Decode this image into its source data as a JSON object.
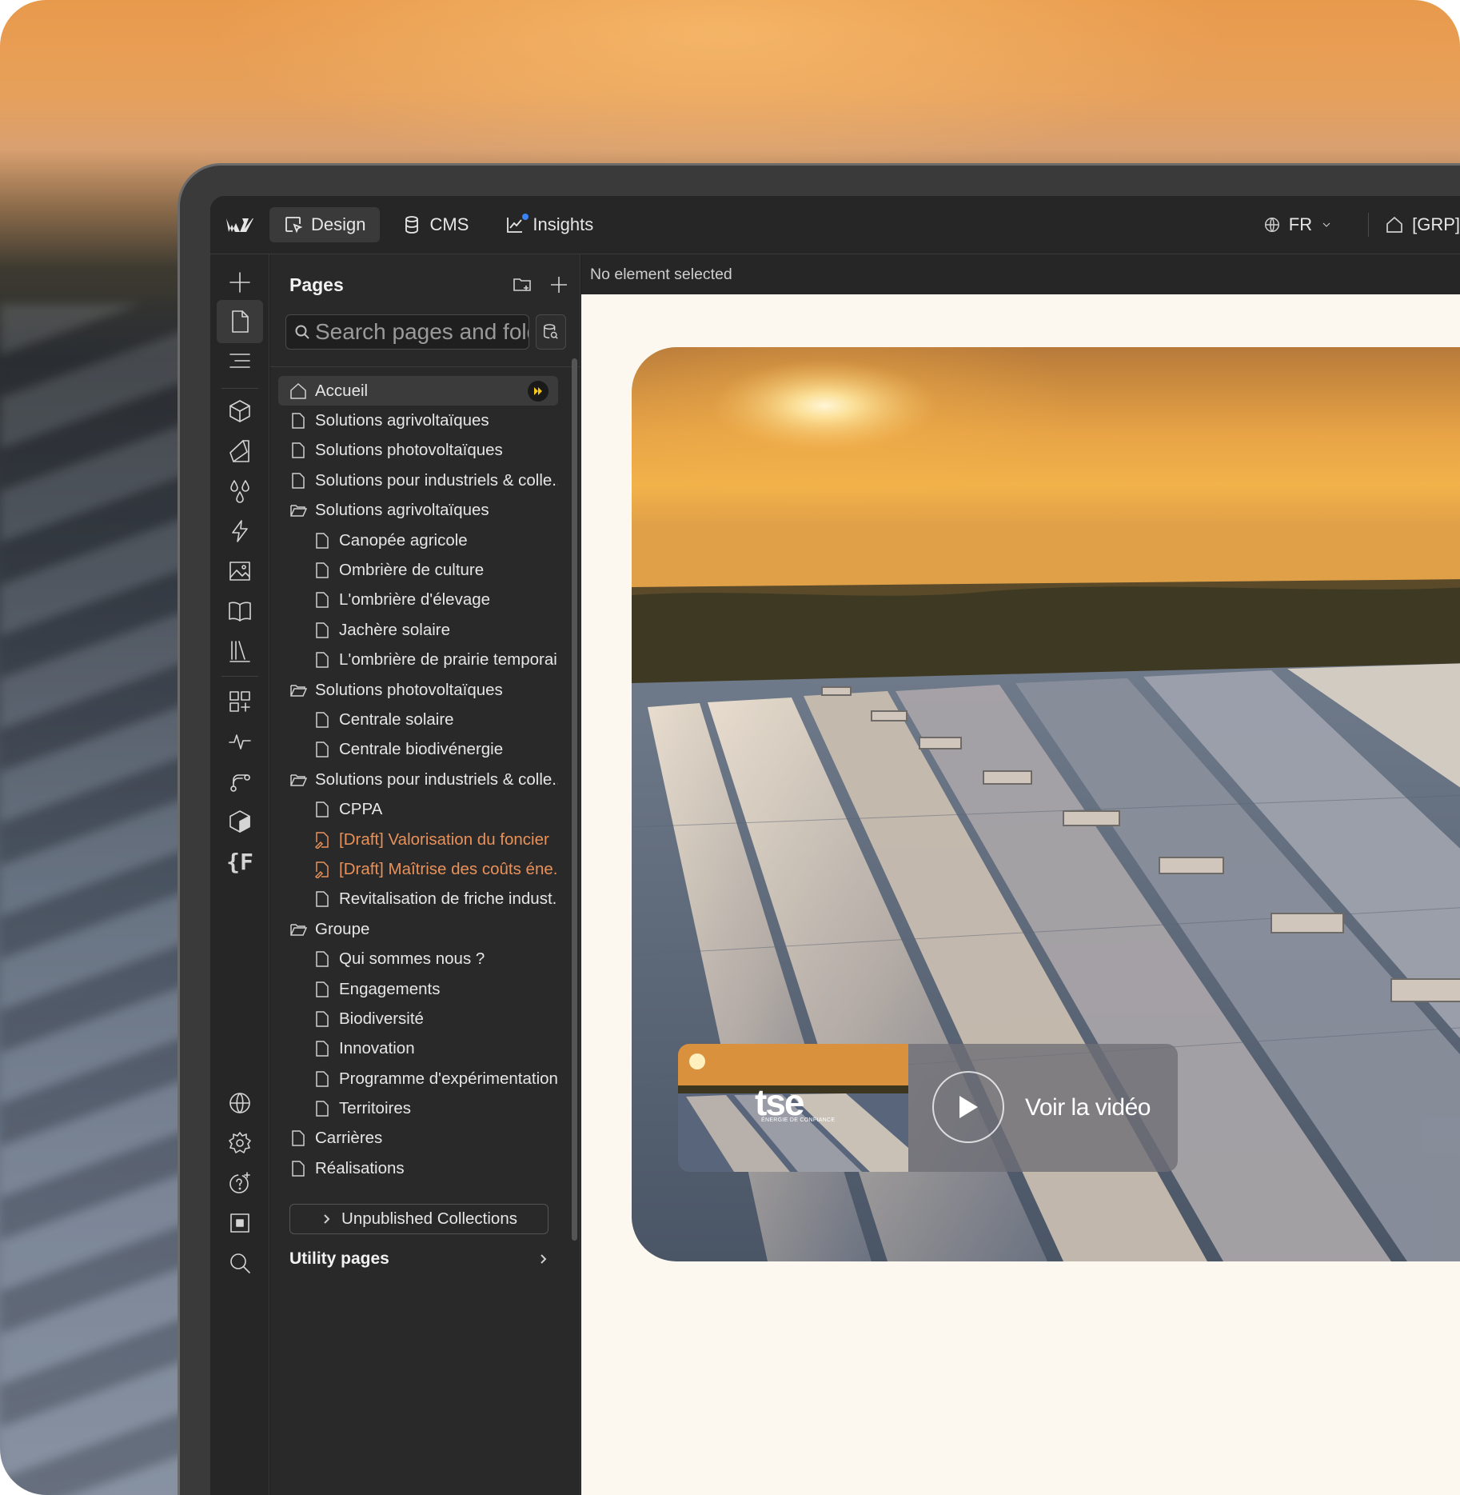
{
  "topbar": {
    "tabs": [
      {
        "label": "Design",
        "icon": "cursor-frame-icon",
        "active": true
      },
      {
        "label": "CMS",
        "icon": "database-icon"
      },
      {
        "label": "Insights",
        "icon": "chart-line-icon"
      }
    ],
    "language": "FR",
    "site_label": "[GRP]"
  },
  "pages_panel": {
    "title": "Pages",
    "search_placeholder": "Search pages and folders",
    "items": [
      {
        "label": "Accueil",
        "type": "home",
        "level": 0,
        "active": true
      },
      {
        "label": "Solutions agrivoltaïques",
        "type": "page",
        "level": 0
      },
      {
        "label": "Solutions photovoltaïques",
        "type": "page",
        "level": 0
      },
      {
        "label": "Solutions pour industriels & colle...",
        "type": "page",
        "level": 0
      },
      {
        "label": "Solutions agrivoltaïques",
        "type": "folder",
        "level": 0
      },
      {
        "label": "Canopée agricole",
        "type": "page",
        "level": 1
      },
      {
        "label": "Ombrière de culture",
        "type": "page",
        "level": 1
      },
      {
        "label": "L'ombrière d'élevage",
        "type": "page",
        "level": 1
      },
      {
        "label": "Jachère solaire",
        "type": "page",
        "level": 1
      },
      {
        "label": "L'ombrière de prairie temporai...",
        "type": "page",
        "level": 1
      },
      {
        "label": "Solutions photovoltaïques",
        "type": "folder",
        "level": 0
      },
      {
        "label": "Centrale solaire",
        "type": "page",
        "level": 1
      },
      {
        "label": "Centrale biodivénergie",
        "type": "page",
        "level": 1
      },
      {
        "label": "Solutions pour industriels & colle...",
        "type": "folder",
        "level": 0
      },
      {
        "label": "CPPA",
        "type": "page",
        "level": 1
      },
      {
        "label": "[Draft] Valorisation du foncier",
        "type": "draft",
        "level": 1
      },
      {
        "label": "[Draft] Maîtrise des coûts éne...",
        "type": "draft",
        "level": 1
      },
      {
        "label": "Revitalisation de friche indust...",
        "type": "page",
        "level": 1
      },
      {
        "label": "Groupe",
        "type": "folder",
        "level": 0
      },
      {
        "label": "Qui sommes nous ?",
        "type": "page",
        "level": 1
      },
      {
        "label": "Engagements",
        "type": "page",
        "level": 1
      },
      {
        "label": "Biodiversité",
        "type": "page",
        "level": 1
      },
      {
        "label": "Innovation",
        "type": "page",
        "level": 1
      },
      {
        "label": "Programme d'expérimentation",
        "type": "page",
        "level": 1
      },
      {
        "label": "Territoires",
        "type": "page",
        "level": 1
      },
      {
        "label": "Carrières",
        "type": "page",
        "level": 0
      },
      {
        "label": "Réalisations",
        "type": "page",
        "level": 0
      }
    ],
    "unpublished_collections": "Unpublished Collections",
    "utility_pages": "Utility pages"
  },
  "canvas": {
    "status": "No element selected",
    "video_logo": "tse",
    "video_logo_sub": "ÉNERGIE DE CONFIANCE",
    "video_cta": "Voir la vidéo"
  },
  "colors": {
    "draft": "#e8915a",
    "accent_blue": "#3b82f6",
    "badge_yellow": "#f5c518",
    "canvas_bg": "#fcf8ef"
  }
}
